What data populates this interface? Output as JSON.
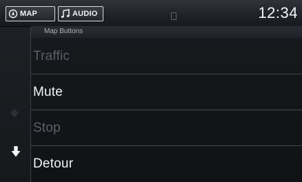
{
  "header": {
    "map_tab": "MAP",
    "audio_tab": "AUDIO",
    "map_icon": "navigation-circle-icon",
    "audio_icon": "music-note-icon",
    "clock": "12:34"
  },
  "section": {
    "title": "Map Buttons"
  },
  "list": {
    "items": [
      {
        "label": "Traffic",
        "enabled": false
      },
      {
        "label": "Mute",
        "enabled": true
      },
      {
        "label": "Stop",
        "enabled": false
      },
      {
        "label": "Detour",
        "enabled": true
      }
    ]
  },
  "colors": {
    "text_enabled": "#f2f4f7",
    "text_disabled": "#5b6068",
    "divider": "#4a4f56"
  }
}
